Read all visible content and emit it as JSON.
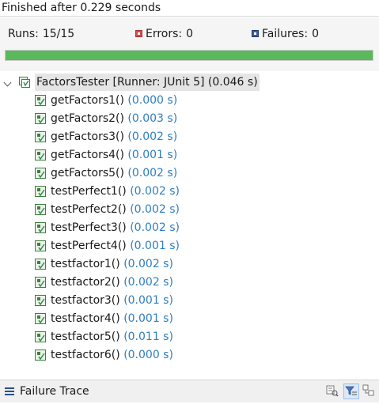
{
  "status": {
    "message": "Finished after 0.229 seconds"
  },
  "counters": {
    "runs_label": "Runs:",
    "runs_value": "15/15",
    "errors_label": "Errors:",
    "errors_value": "0",
    "failures_label": "Failures:",
    "failures_value": "0"
  },
  "progress": {
    "fraction": 1.0,
    "color": "#5cb85c"
  },
  "tree": {
    "root": {
      "label": "FactorsTester [Runner: JUnit 5]",
      "time": "(0.046 s)",
      "expanded": true
    },
    "tests": [
      {
        "name": "getFactors1()",
        "time": "(0.000 s)"
      },
      {
        "name": "getFactors2()",
        "time": "(0.003 s)"
      },
      {
        "name": "getFactors3()",
        "time": "(0.002 s)"
      },
      {
        "name": "getFactors4()",
        "time": "(0.001 s)"
      },
      {
        "name": "getFactors5()",
        "time": "(0.002 s)"
      },
      {
        "name": "testPerfect1()",
        "time": "(0.002 s)"
      },
      {
        "name": "testPerfect2()",
        "time": "(0.002 s)"
      },
      {
        "name": "testPerfect3()",
        "time": "(0.002 s)"
      },
      {
        "name": "testPerfect4()",
        "time": "(0.001 s)"
      },
      {
        "name": "testfactor1()",
        "time": "(0.002 s)"
      },
      {
        "name": "testfactor2()",
        "time": "(0.002 s)"
      },
      {
        "name": "testfactor3()",
        "time": "(0.001 s)"
      },
      {
        "name": "testfactor4()",
        "time": "(0.001 s)"
      },
      {
        "name": "testfactor5()",
        "time": "(0.011 s)"
      },
      {
        "name": "testfactor6()",
        "time": "(0.000 s)"
      }
    ]
  },
  "failure_trace": {
    "title": "Failure Trace"
  },
  "icons": {
    "errors": "error-icon",
    "failures": "failure-icon",
    "root": "test-suite-icon",
    "test": "test-pass-icon",
    "trace": "failure-trace-icon",
    "toolbar": [
      "compare-result-icon",
      "filter-stack-icon",
      "copy-trace-icon"
    ]
  }
}
